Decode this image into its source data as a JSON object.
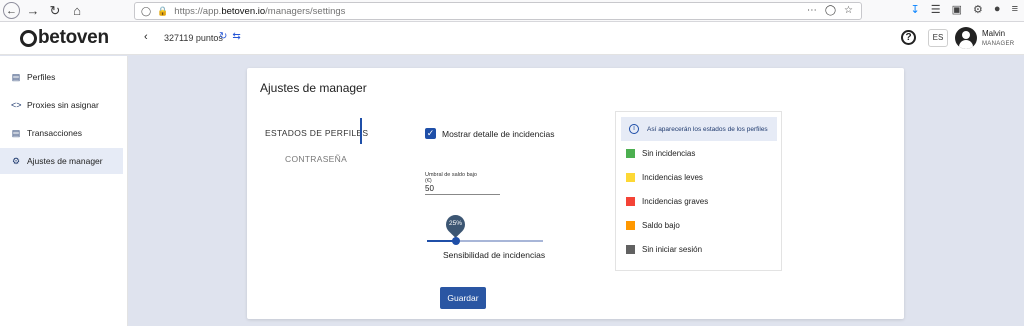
{
  "browser": {
    "url_prefix": "https://app.",
    "url_domain": "betoven.io",
    "url_path": "/managers/settings"
  },
  "header": {
    "logo_text": "betoven",
    "points_text": "327119 puntos",
    "lang": "ES",
    "user_name": "Malvin",
    "user_role": "MANAGER"
  },
  "sidebar": {
    "items": [
      {
        "label": "Perfiles",
        "icon": "profile-card-icon"
      },
      {
        "label": "Proxies sin asignar",
        "icon": "code-arrows-icon"
      },
      {
        "label": "Transacciones",
        "icon": "document-icon"
      },
      {
        "label": "Ajustes de manager",
        "icon": "gear-icon"
      }
    ],
    "active_index": 3
  },
  "settings": {
    "title": "Ajustes de manager",
    "tabs": [
      {
        "label": "ESTADOS DE PERFILES"
      },
      {
        "label": "CONTRASEÑA"
      }
    ],
    "checkbox_label": "Mostrar detalle de incidencias",
    "checkbox_checked": true,
    "threshold_label_line1": "Umbral de saldo bajo",
    "threshold_label_line2": "(€)",
    "threshold_value": "50",
    "slider_value_label": "25%",
    "slider_value": 0.25,
    "slider_label": "Sensibilidad de incidencias",
    "save_label": "Guardar",
    "legend_info": "Así aparecerán los estados de los perfiles",
    "legend": [
      {
        "label": "Sin incidencias",
        "color": "#4caf50"
      },
      {
        "label": "Incidencias leves",
        "color": "#fdd835"
      },
      {
        "label": "Incidencias graves",
        "color": "#f44336"
      },
      {
        "label": "Saldo bajo",
        "color": "#ff9800"
      },
      {
        "label": "Sin iniciar sesión",
        "color": "#616161"
      }
    ]
  }
}
